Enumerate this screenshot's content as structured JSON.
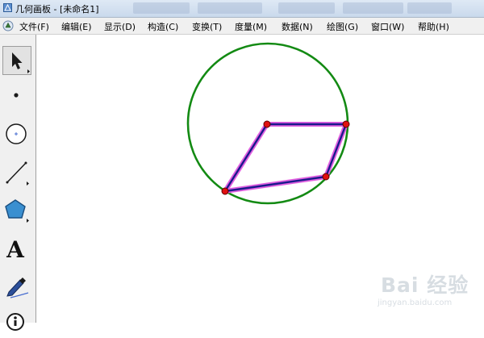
{
  "window": {
    "title": "几何画板 - [未命名1]"
  },
  "menubar": {
    "items": [
      "文件(F)",
      "编辑(E)",
      "显示(D)",
      "构造(C)",
      "变换(T)",
      "度量(M)",
      "数据(N)",
      "绘图(G)",
      "窗口(W)",
      "帮助(H)"
    ]
  },
  "toolbox": {
    "text_tool_glyph": "A",
    "icons": [
      "arrow-select-icon",
      "point-icon",
      "compass-circle-icon",
      "straightedge-line-icon",
      "polygon-icon",
      "text-icon",
      "marker-pen-icon",
      "info-icon"
    ]
  },
  "canvas": {
    "colors": {
      "circle": "#138a13",
      "polygon_edge": "#1a1a8c",
      "polygon_highlight": "#e060e0",
      "point_fill": "#e01010",
      "point_stroke": "#600000"
    }
  },
  "watermark": {
    "text": "Bai 经验",
    "sub": "jingyan.baidu.com"
  }
}
